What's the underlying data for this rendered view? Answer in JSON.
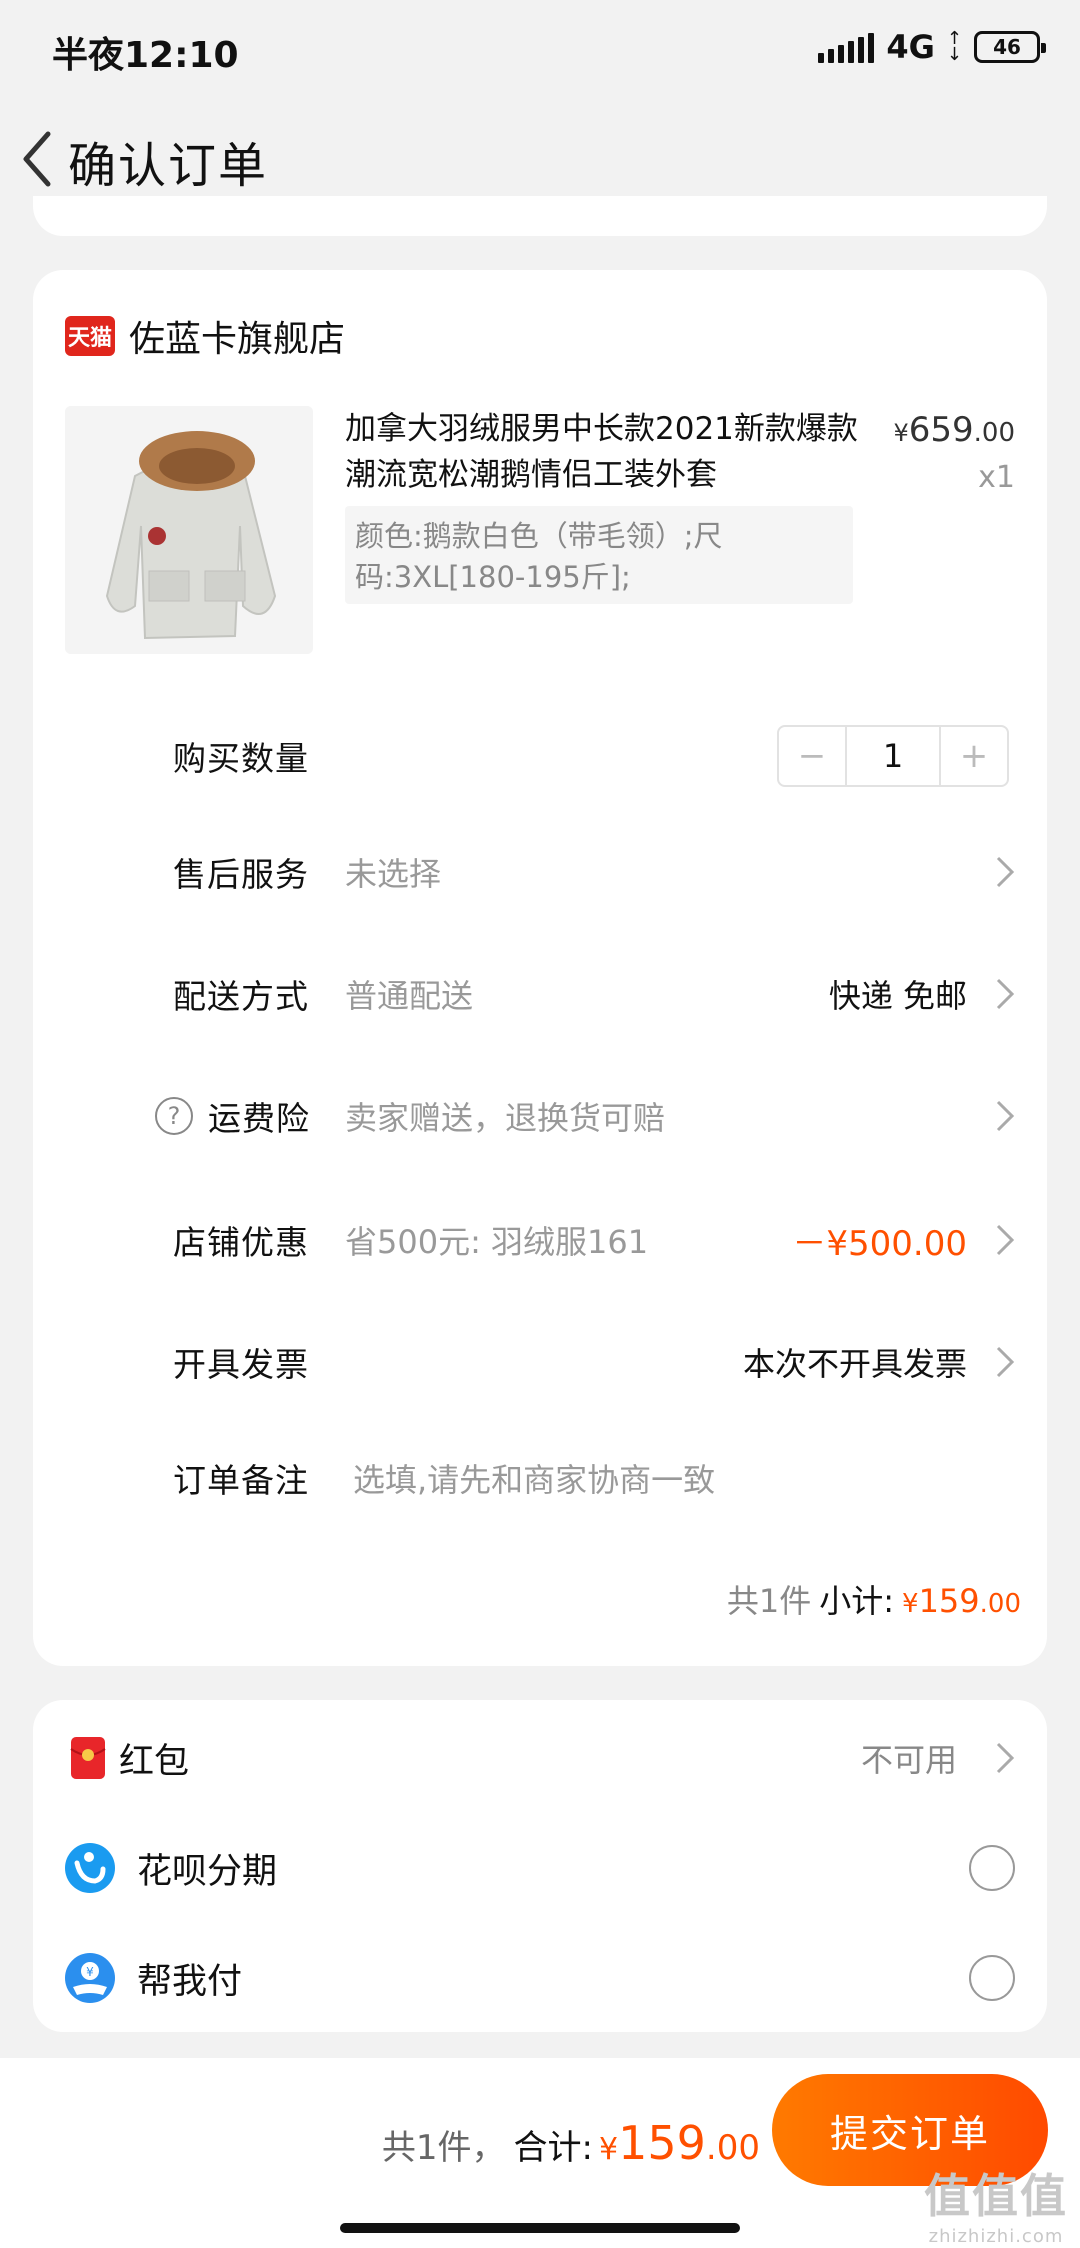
{
  "status_bar": {
    "time": "半夜12:10",
    "network": "4G",
    "battery": "46"
  },
  "header": {
    "title": "确认订单"
  },
  "shop": {
    "badge": "天猫",
    "name": "佐蓝卡旗舰店"
  },
  "product": {
    "title": "加拿大羽绒服男中长款2021新款爆款潮流宽松潮鹅情侣工装外套",
    "price_symbol": "¥",
    "price_int": "659",
    "price_cents": ".00",
    "quantity": "x1",
    "spec": "颜色:鹅款白色（带毛领）;尺码:3XL[180-195斤];"
  },
  "rows": {
    "quantity": {
      "label": "购买数量",
      "minus": "−",
      "value": "1",
      "plus": "+"
    },
    "after_sales": {
      "label": "售后服务",
      "value": "未选择"
    },
    "delivery": {
      "label": "配送方式",
      "value": "普通配送",
      "right": "快递 免邮"
    },
    "freight_insurance": {
      "label": "运费险",
      "help": "?",
      "value": "卖家赠送，退换货可赔"
    },
    "shop_discount": {
      "label": "店铺优惠",
      "value": "省500元: 羽绒服161",
      "right": "－¥500.00"
    },
    "invoice": {
      "label": "开具发票",
      "right": "本次不开具发票"
    },
    "remark": {
      "label": "订单备注",
      "placeholder": "选填,请先和商家协商一致"
    }
  },
  "subtotal": {
    "count": "共1件",
    "label": "小计:",
    "symbol": "¥",
    "int": "159",
    "cents": ".00"
  },
  "payment": {
    "red_packet": {
      "label": "红包",
      "status": "不可用",
      "icon": "red-packet-icon"
    },
    "huabei": {
      "label": "花呗分期",
      "icon": "huabei-icon"
    },
    "pay_for_me": {
      "label": "帮我付",
      "icon": "pay-for-me-icon"
    }
  },
  "bottom_bar": {
    "count": "共1件，",
    "label": "合计:",
    "symbol": "¥",
    "int": "159",
    "cents": ".00",
    "submit": "提交订单"
  },
  "watermark": {
    "main": "值值值",
    "sub": "zhizhizhi.com"
  },
  "colors": {
    "accent": "#ff5000",
    "tmall_red": "#e0261c",
    "background": "#f2f2f2"
  }
}
